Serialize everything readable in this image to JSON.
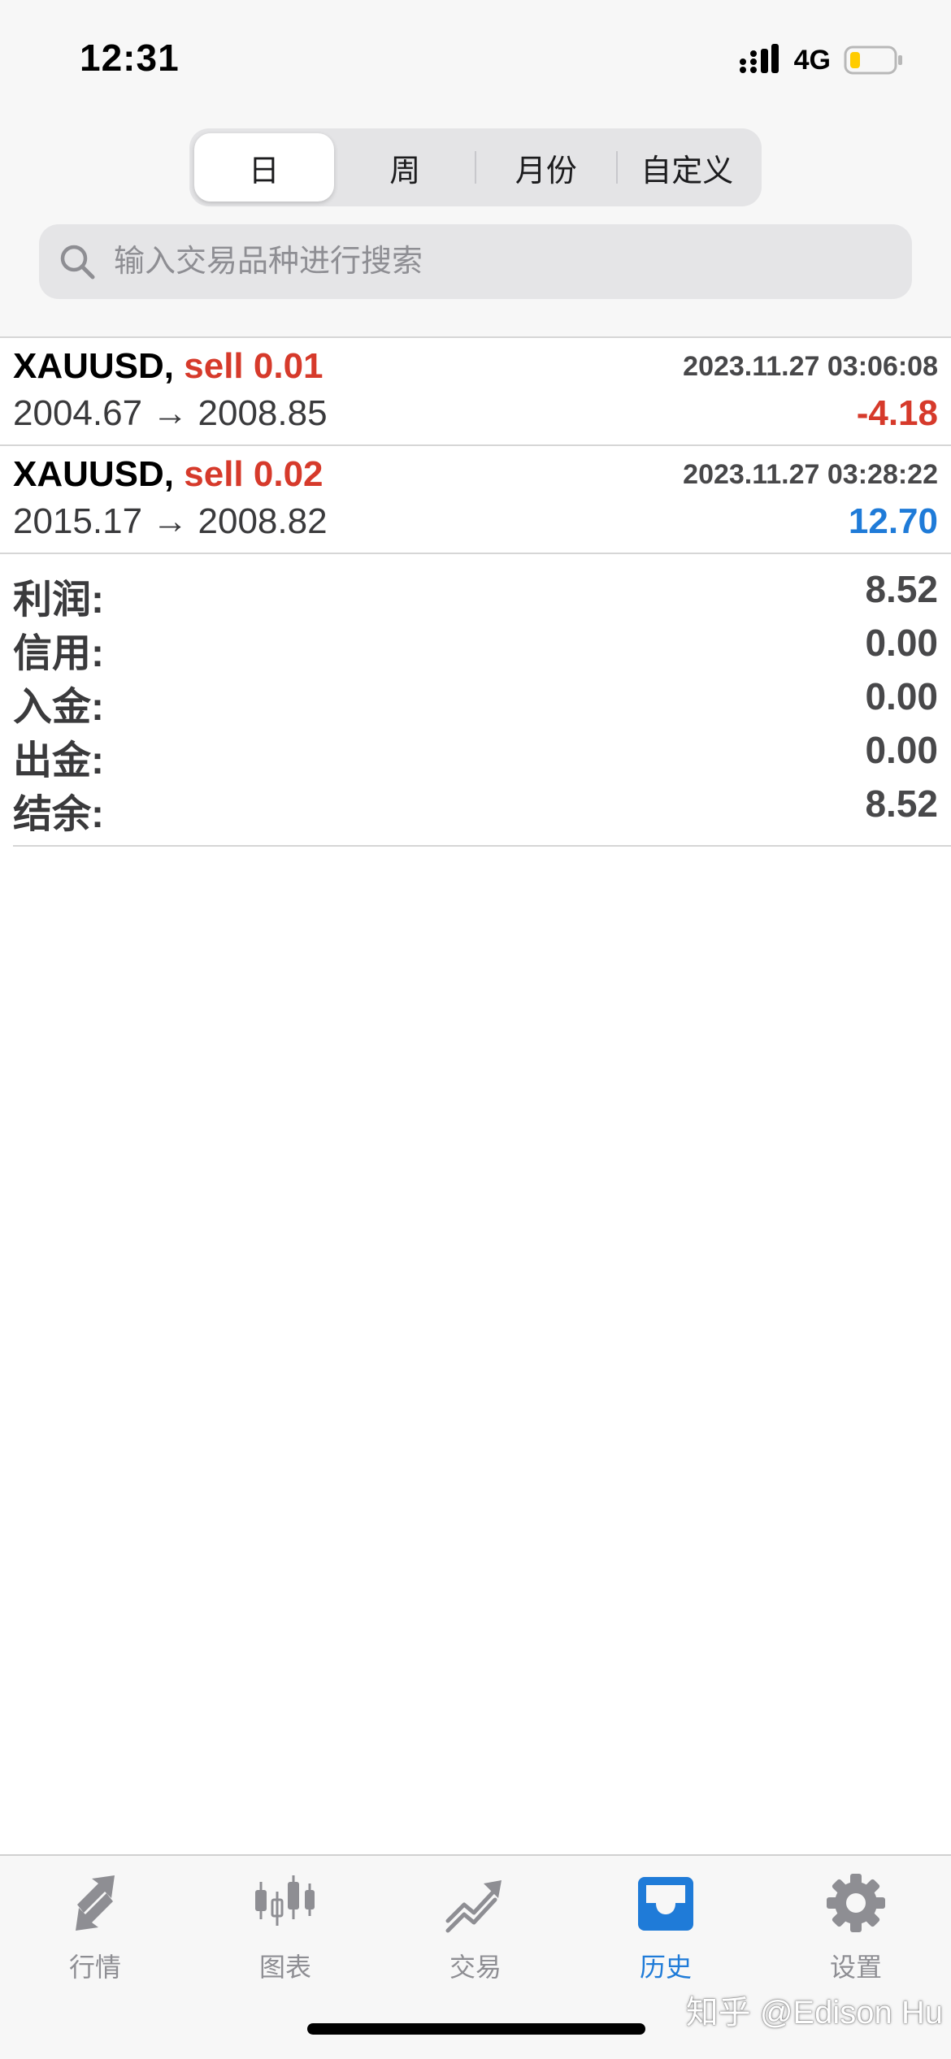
{
  "status_bar": {
    "time": "12:31",
    "network": "4G"
  },
  "period_tabs": [
    {
      "label": "日",
      "active": true
    },
    {
      "label": "周",
      "active": false
    },
    {
      "label": "月份",
      "active": false
    },
    {
      "label": "自定义",
      "active": false
    }
  ],
  "search": {
    "placeholder": "输入交易品种进行搜索",
    "value": ""
  },
  "deals": [
    {
      "symbol": "XAUUSD,",
      "type": "sell 0.01",
      "time": "2023.11.27 03:06:08",
      "prices": "2004.67 → 2008.85",
      "profit": "-4.18",
      "profit_color": "#d63a2b"
    },
    {
      "symbol": "XAUUSD,",
      "type": "sell 0.02",
      "time": "2023.11.27 03:28:22",
      "prices": "2015.17 → 2008.82",
      "profit": "12.70",
      "profit_color": "#1f7bd8"
    }
  ],
  "summary": [
    {
      "label": "利润:",
      "value": "8.52"
    },
    {
      "label": "信用:",
      "value": "0.00"
    },
    {
      "label": "入金:",
      "value": "0.00"
    },
    {
      "label": "出金:",
      "value": "0.00"
    },
    {
      "label": "结余:",
      "value": "8.52"
    }
  ],
  "tab_bar": [
    {
      "label": "行情",
      "icon": "quotes-arrows-icon",
      "active": false
    },
    {
      "label": "图表",
      "icon": "candlestick-chart-icon",
      "active": false
    },
    {
      "label": "交易",
      "icon": "trade-trend-icon",
      "active": false
    },
    {
      "label": "历史",
      "icon": "history-inbox-icon",
      "active": true
    },
    {
      "label": "设置",
      "icon": "gear-icon",
      "active": false
    }
  ],
  "watermark": "知乎 @Edison Hu",
  "colors": {
    "accent_blue": "#1f7bd8",
    "loss_red": "#d63a2b",
    "inactive_gray": "#8e8e93"
  }
}
